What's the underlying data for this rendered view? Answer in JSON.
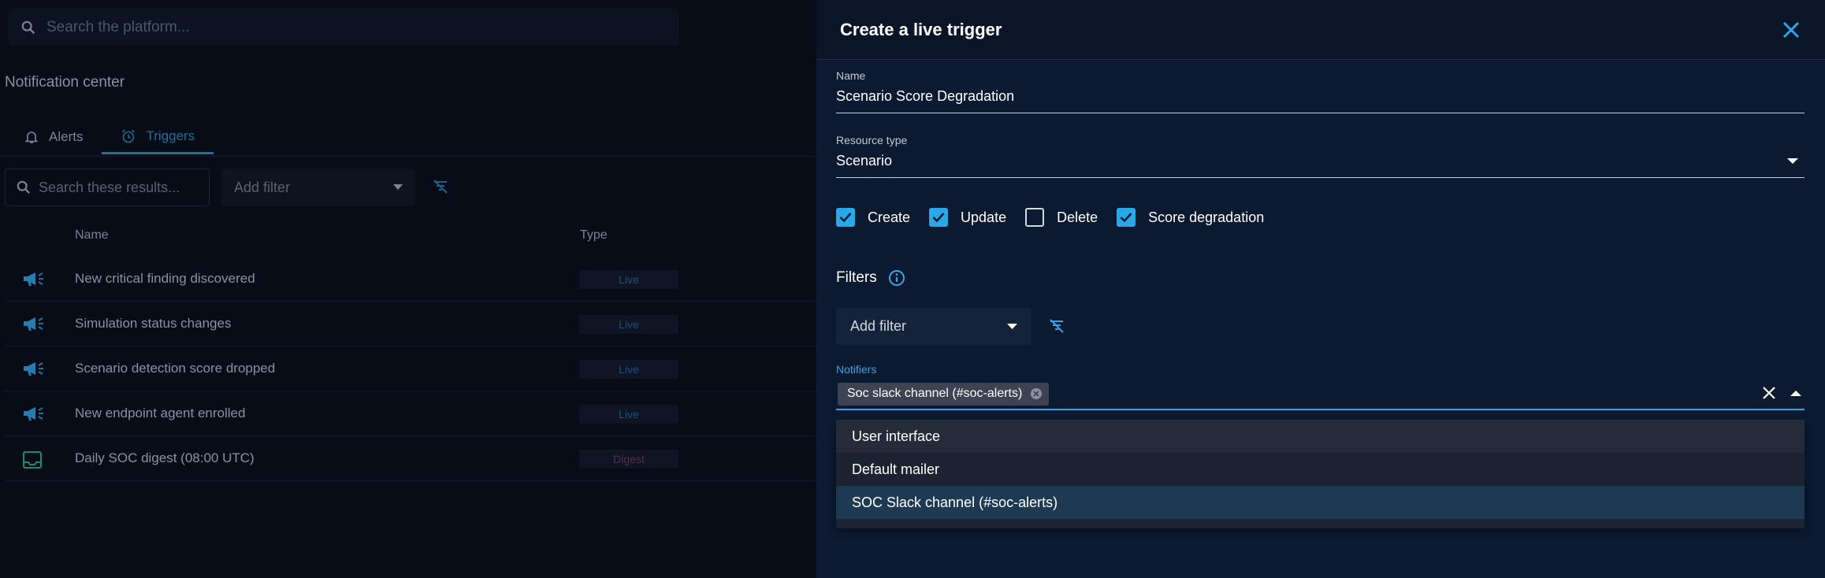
{
  "background": {
    "search_placeholder": "Search the platform...",
    "page_title": "Notification center",
    "tabs": [
      {
        "label": "Alerts"
      },
      {
        "label": "Triggers"
      }
    ],
    "list_search_placeholder": "Search these results...",
    "add_filter_label": "Add filter",
    "columns": {
      "name": "Name",
      "type": "Type"
    },
    "rows": [
      {
        "name": "New critical finding discovered",
        "type": "Live"
      },
      {
        "name": "Simulation status changes",
        "type": "Live"
      },
      {
        "name": "Scenario detection score dropped",
        "type": "Live"
      },
      {
        "name": "New endpoint agent enrolled",
        "type": "Live"
      },
      {
        "name": "Daily SOC digest (08:00 UTC)",
        "type": "Digest"
      }
    ]
  },
  "drawer": {
    "title": "Create a live trigger",
    "name_label": "Name",
    "name_value": "Scenario Score Degradation",
    "resource_type_label": "Resource type",
    "resource_type_value": "Scenario",
    "events": [
      {
        "label": "Create",
        "checked": true
      },
      {
        "label": "Update",
        "checked": true
      },
      {
        "label": "Delete",
        "checked": false
      },
      {
        "label": "Score degradation",
        "checked": true
      }
    ],
    "filters_label": "Filters",
    "add_filter_label": "Add filter",
    "notifiers_label": "Notifiers",
    "selected_notifier": "Soc slack channel (#soc-alerts)",
    "options": [
      {
        "label": "User interface"
      },
      {
        "label": "Default mailer"
      },
      {
        "label": "SOC Slack channel (#soc-alerts)"
      }
    ]
  },
  "colors": {
    "accent": "#29a8e8",
    "drawer_bg": "#0b1a31",
    "page_bg": "#070c16"
  }
}
